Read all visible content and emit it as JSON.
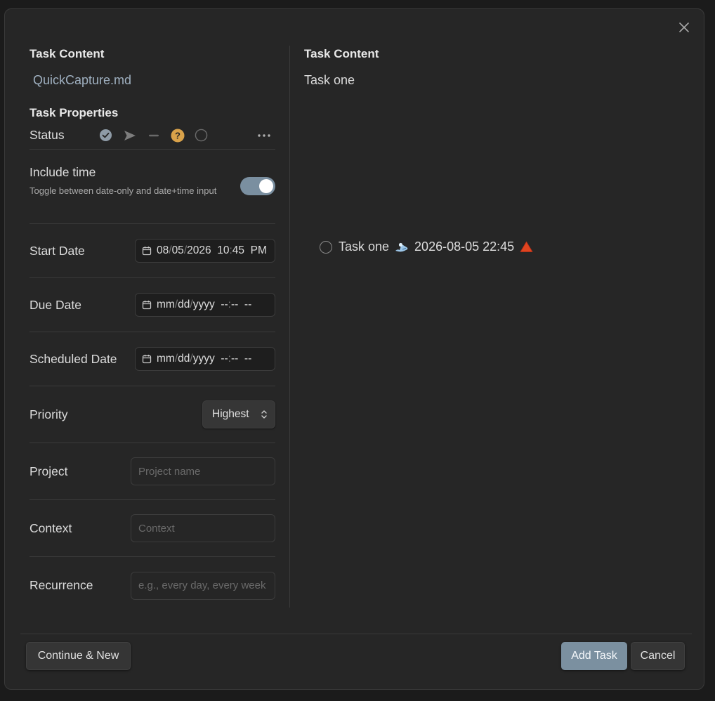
{
  "left": {
    "task_content_heading": "Task Content",
    "file_name": "QuickCapture.md",
    "task_properties_heading": "Task Properties",
    "status": {
      "label": "Status",
      "icons": [
        "check-circle-icon",
        "send-arrow-icon",
        "dash-icon",
        "question-circle-icon",
        "empty-circle-icon"
      ],
      "more_icon": "ellipsis-icon"
    },
    "include_time": {
      "label": "Include time",
      "description": "Toggle between date-only and date+time input",
      "enabled": true
    },
    "start_date": {
      "label": "Start Date",
      "month": "08",
      "day": "05",
      "year": "2026",
      "hour": "10",
      "minute": "45",
      "ampm": "PM"
    },
    "due_date": {
      "label": "Due Date",
      "month": "mm",
      "day": "dd",
      "year": "yyyy",
      "hour": "--",
      "minute": "--",
      "ampm": "--"
    },
    "scheduled_date": {
      "label": "Scheduled Date",
      "month": "mm",
      "day": "dd",
      "year": "yyyy",
      "hour": "--",
      "minute": "--",
      "ampm": "--"
    },
    "priority": {
      "label": "Priority",
      "value": "Highest"
    },
    "project": {
      "label": "Project",
      "placeholder": "Project name"
    },
    "context": {
      "label": "Context",
      "placeholder": "Context"
    },
    "recurrence": {
      "label": "Recurrence",
      "placeholder": "e.g., every day, every week"
    }
  },
  "right": {
    "task_content_heading": "Task Content",
    "task_text": "Task one",
    "preview": {
      "text": "Task one",
      "start_icon": "start-date-icon",
      "datetime": "2026-08-05 22:45",
      "priority_icon": "red-triangle-icon"
    }
  },
  "footer": {
    "continue_label": "Continue & New",
    "add_label": "Add Task",
    "cancel_label": "Cancel"
  },
  "colors": {
    "accent": "#7b90a0",
    "priority_highest": "#e0441f",
    "question_status": "#d9a24a"
  }
}
